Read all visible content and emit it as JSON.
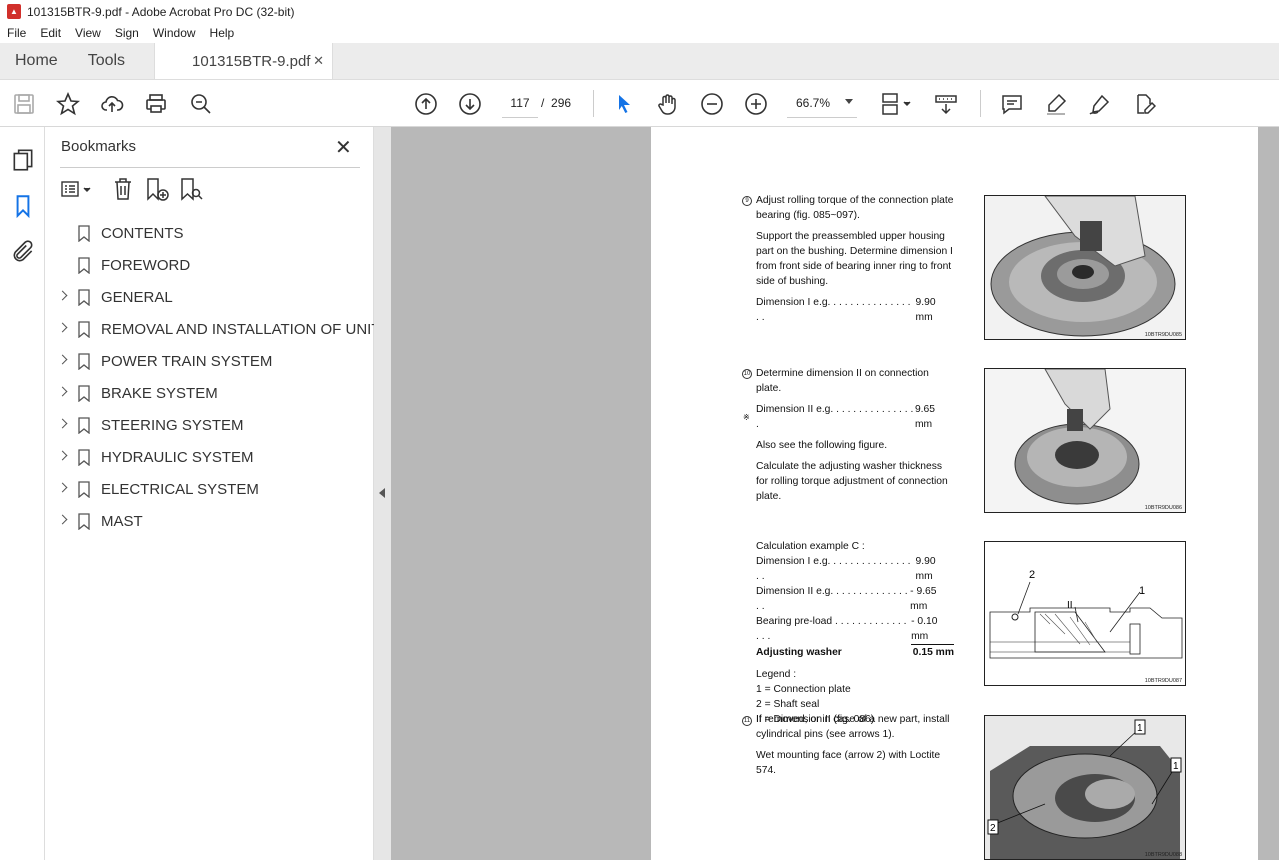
{
  "window": {
    "title": "101315BTR-9.pdf - Adobe Acrobat Pro DC (32-bit)"
  },
  "menu": [
    "File",
    "Edit",
    "View",
    "Sign",
    "Window",
    "Help"
  ],
  "tabs": {
    "home": "Home",
    "tools": "Tools",
    "document": "101315BTR-9.pdf"
  },
  "toolbar": {
    "current_page": "117",
    "page_sep": "/",
    "total_pages": "296",
    "zoom": "66.7%"
  },
  "bookmarks": {
    "title": "Bookmarks",
    "items": [
      {
        "label": "CONTENTS",
        "expandable": false
      },
      {
        "label": "FOREWORD",
        "expandable": false
      },
      {
        "label": "GENERAL",
        "expandable": true
      },
      {
        "label": "REMOVAL AND INSTALLATION OF UNIT",
        "expandable": true
      },
      {
        "label": "POWER TRAIN SYSTEM",
        "expandable": true
      },
      {
        "label": "BRAKE SYSTEM",
        "expandable": true
      },
      {
        "label": "STEERING SYSTEM",
        "expandable": true
      },
      {
        "label": "HYDRAULIC SYSTEM",
        "expandable": true
      },
      {
        "label": "ELECTRICAL SYSTEM",
        "expandable": true
      },
      {
        "label": "MAST",
        "expandable": true
      }
    ]
  },
  "doc": {
    "s9": {
      "num": "9",
      "p1": "Adjust rolling torque of the connection plate bearing (fig. 085~097).",
      "p2": "Support the preassembled upper housing part on the bushing. Determine dimension I from front side of bearing inner ring to front side of bushing.",
      "dim_label": "Dimension I e.g. . . . . . . . . . . . . . . . .",
      "dim_value": "9.90 mm",
      "fig": "10BTR9DU085"
    },
    "s10": {
      "num": "10",
      "p1": "Determine dimension II on connection plate.",
      "dim_label": "Dimension II e.g.  . . . . . . . . . . . . . . .",
      "dim_value": "9.65 mm",
      "note_mark": "※",
      "note": "Also see the following figure.",
      "p2": "Calculate the adjusting washer thickness for rolling torque adjustment of connection plate.",
      "fig": "10BTR9DU086"
    },
    "calc": {
      "title": "Calculation example C :",
      "r1_label": "Dimension I e.g. . . . . . . . . . . . . . . . .",
      "r1_value": "9.90 mm",
      "r2_label": "Dimension II e.g.  . . . . . . . . . . . . . . .",
      "r2_value": "- 9.65 mm",
      "r3_label": "Bearing pre-load . . . . . . . . . . . . . . . .",
      "r3_value": "- 0.10 mm",
      "r4_label": "Adjusting washer",
      "r4_value": "0.15 mm",
      "legend_title": "Legend :",
      "legend": [
        "1 = Connection plate",
        "2 = Shaft seal",
        "II = Dimension II (fig. 086)"
      ],
      "fig": "10BTR9DU087",
      "fig_labels": {
        "a": "2",
        "b": "II",
        "c": "1"
      }
    },
    "s11": {
      "num": "11",
      "p1": "If removed, or in case of a new part, install cylindrical pins (see arrows 1).",
      "p2": "Wet mounting face (arrow 2) with Loctite 574.",
      "fig": "10BTR9DU088",
      "fig_labels": {
        "a": "1",
        "b": "1",
        "c": "2"
      }
    }
  }
}
